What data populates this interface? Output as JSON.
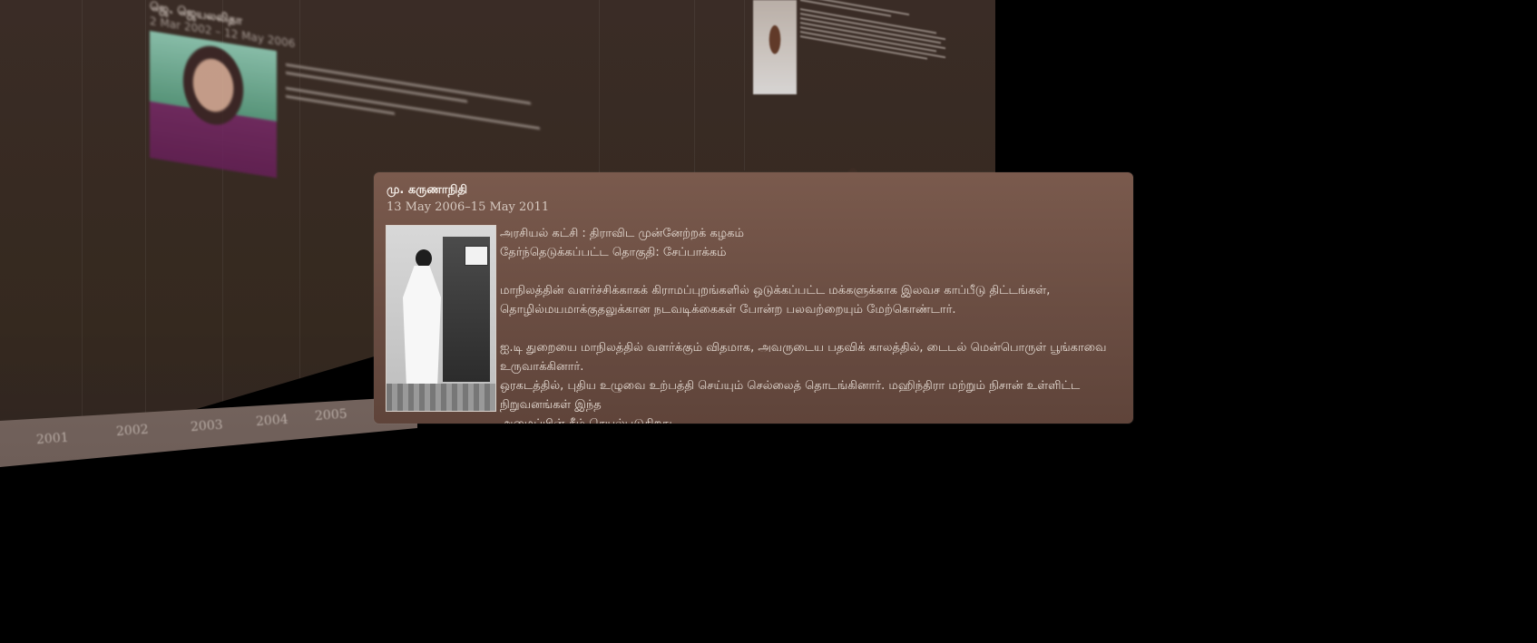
{
  "timeline": {
    "years": [
      "2001",
      "2002",
      "2003",
      "2004",
      "2005"
    ],
    "background_entries": {
      "left": {
        "name": "ஜெ. ஜெயலலிதா",
        "dates": "2 Mar 2002 – 12 May 2006"
      }
    }
  },
  "card": {
    "name": "மு. கருணாநிதி",
    "dates": "13 May 2006–15 May 2011",
    "party_line": "அரசியல் கட்சி : திராவிட முன்னேற்றக் கழகம்",
    "constituency_line": "தேர்ந்தெடுக்கப்பட்ட தொகுதி: சேப்பாக்கம்",
    "paragraph1_line1": "மாநிலத்தின் வளர்ச்சிக்காகக் கிராமப்புறங்களில் ஒடுக்கப்பட்ட மக்களுக்காக இலவச காப்பீடு திட்டங்கள்,",
    "paragraph1_line2": "தொழில்மயமாக்குதலுக்கான நடவடிக்கைகள் போன்ற பலவற்றையும் மேற்கொண்டார்.",
    "paragraph2_line1": "ஐ.டி துறையை மாநிலத்தில் வளர்க்கும் விதமாக, அவருடைய பதவிக் காலத்தில், டைடல் மென்பொருள் பூங்காவை உருவாக்கினார்.",
    "paragraph2_line2": "ஒரகடத்தில், புதிய உழுவை உற்பத்தி செய்யும் செல்லைத் தொடங்கினார். மஹிந்திரா மற்றும் நிசான் உள்ளிட்ட நிறுவனங்கள் இந்த",
    "paragraph2_line3": "அமைப்பின் கீழ் செயல்படுகிறது."
  },
  "colors": {
    "card_background": "#6a4d42",
    "wall_background": "#35291f",
    "page_background": "#000000"
  }
}
